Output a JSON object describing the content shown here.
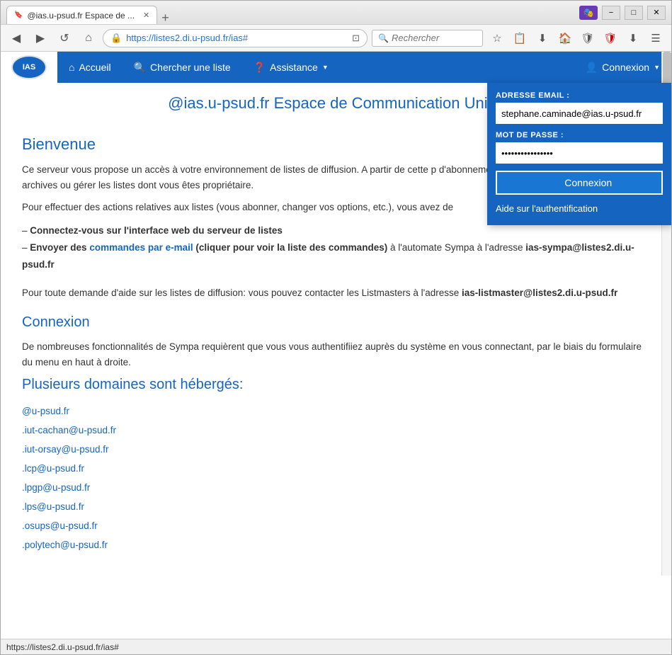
{
  "browser": {
    "tab_title": "@ias.u-psud.fr Espace de ...",
    "tab_favicon": "🔖",
    "new_tab_label": "+",
    "address": "https://listes2.di.u-psud.fr/ias#",
    "search_placeholder": "Rechercher",
    "back_icon": "◀",
    "forward_icon": "▶",
    "refresh_icon": "↺",
    "home_icon": "⌂",
    "lock_icon": "🔒",
    "minimize": "−",
    "maximize": "□",
    "close": "✕",
    "status_url": "https://listes2.di.u-psud.fr/ias#",
    "menu_icon": "☰"
  },
  "navbar": {
    "logo_text": "IAS",
    "accueil_icon": "⌂",
    "accueil_label": "Accueil",
    "search_icon": "🔍",
    "search_label": "Chercher une liste",
    "assistance_icon": "❓",
    "assistance_label": "Assistance",
    "assistance_caret": "▼",
    "connexion_icon": "👤",
    "connexion_label": "Connexion",
    "connexion_caret": "▼"
  },
  "dropdown": {
    "email_label": "ADRESSE EMAIL :",
    "email_value": "stephane.caminade@ias.u-psud.fr",
    "password_label": "MOT DE PASSE :",
    "password_value": "●●●●●●●●●●●●●●●●",
    "connexion_label": "Connexion",
    "connexion_icon": "👤",
    "auth_help": "Aide sur l'authentification"
  },
  "page": {
    "header": "@ias.u-psud.fr Espace de Communication Unive",
    "welcome_title": "Bienvenue",
    "welcome_text": "Ce serveur vous propose un accès à votre environnement de listes de diffusion. A partir de cette p d'abonnement, vous désabonner, accéder aux archives ou gérer les listes dont vous êtes propriétaire.",
    "action_text": "Pour effectuer des actions relatives aux listes (vous abonner, changer vos options, etc.), vous avez de",
    "bullet1": "– Connectez-vous sur l'interface web du serveur de listes",
    "bullet2": "– Envoyer des",
    "bullet2_link": "commandes par e-mail",
    "bullet2_mid": "(cliquer pour voir la liste des commandes)",
    "bullet2_end": "à l'automate Sympa à l'adresse",
    "bullet2_addr": "ias-sympa@listes2.di.u-psud.fr",
    "help_text": "Pour toute demande d'aide sur les listes de diffusion: vous pouvez contacter les Listmasters à l'adresse",
    "help_addr": "ias-listmaster@listes2.di.u-psud.fr",
    "connexion_title": "Connexion",
    "connexion_desc": "De nombreuses fonctionnalités de Sympa requièrent que vous vous authentifiiez auprès du système en vous connectant, par le biais du formulaire du menu en haut à droite.",
    "domains_title": "Plusieurs domaines sont hébergés:",
    "domains": [
      "@u-psud.fr",
      ".iut-cachan@u-psud.fr",
      ".iut-orsay@u-psud.fr",
      ".lcp@u-psud.fr",
      ".lpgp@u-psud.fr",
      ".lps@u-psud.fr",
      ".osups@u-psud.fr",
      ".polytech@u-psud.fr"
    ]
  }
}
